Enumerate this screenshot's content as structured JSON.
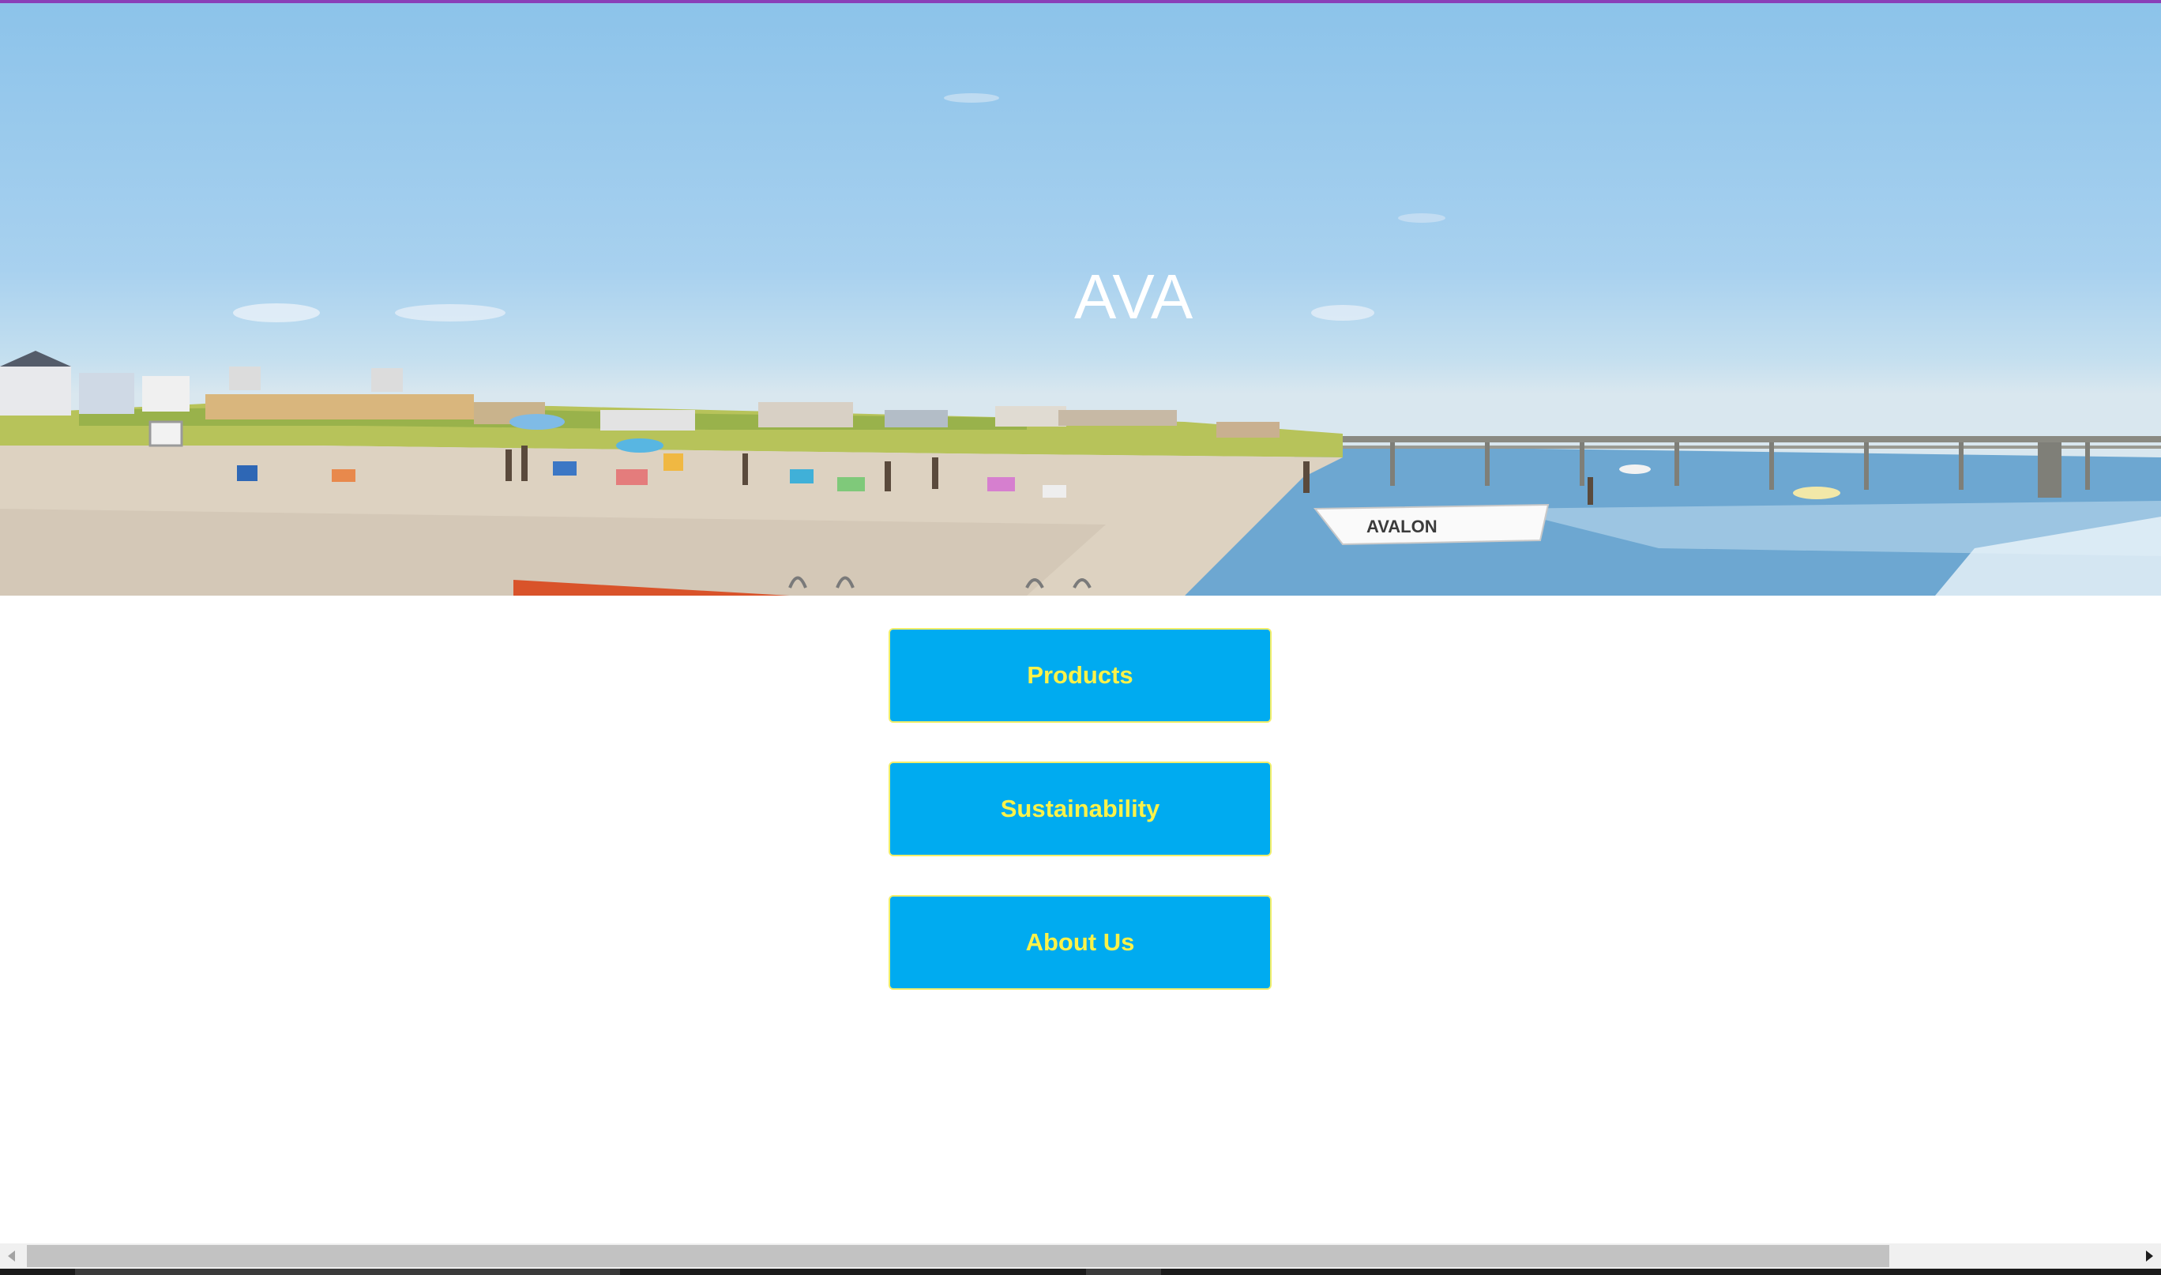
{
  "hero": {
    "title": "AVA",
    "boat_lettering": "AVALON"
  },
  "nav": {
    "buttons": [
      {
        "label": "Products"
      },
      {
        "label": "Sustainability"
      },
      {
        "label": "About Us"
      }
    ]
  },
  "colors": {
    "button_bg": "#00abf0",
    "button_text": "#fbf249",
    "button_border": "#f1ee6a",
    "top_border": "#8a3fb8"
  }
}
